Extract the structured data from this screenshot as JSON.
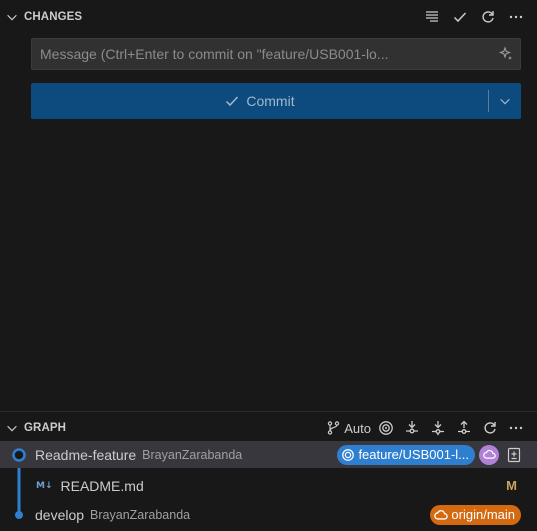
{
  "changes": {
    "title": "CHANGES",
    "message_placeholder": "Message (Ctrl+Enter to commit on \"feature/USB001-lo...",
    "commit_label": "Commit"
  },
  "graph": {
    "title": "GRAPH",
    "auto_label": "Auto",
    "commits": [
      {
        "message": "Readme-feature",
        "author": "BrayanZarabanda",
        "branch_badge": "feature/USB001-l..."
      },
      {
        "message": "develop",
        "author": "BrayanZarabanda",
        "branch_badge": "origin/main"
      }
    ],
    "file": {
      "icon_text": "M↓",
      "name": "README.md",
      "status": "M"
    }
  },
  "colors": {
    "graph_line": "#2f7fd1",
    "branch_badge": "#2f7fd1",
    "origin_badge": "#d36a12",
    "remote_badge": "#b180d7",
    "commit_button": "#0d4a7e"
  },
  "icons": {
    "changes_actions": [
      "view-as-tree-icon",
      "check-icon",
      "refresh-icon",
      "more-icon"
    ],
    "graph_actions": [
      "branch-icon",
      "target-icon",
      "fetch-icon",
      "pull-icon",
      "push-icon",
      "refresh-icon",
      "more-icon"
    ]
  }
}
